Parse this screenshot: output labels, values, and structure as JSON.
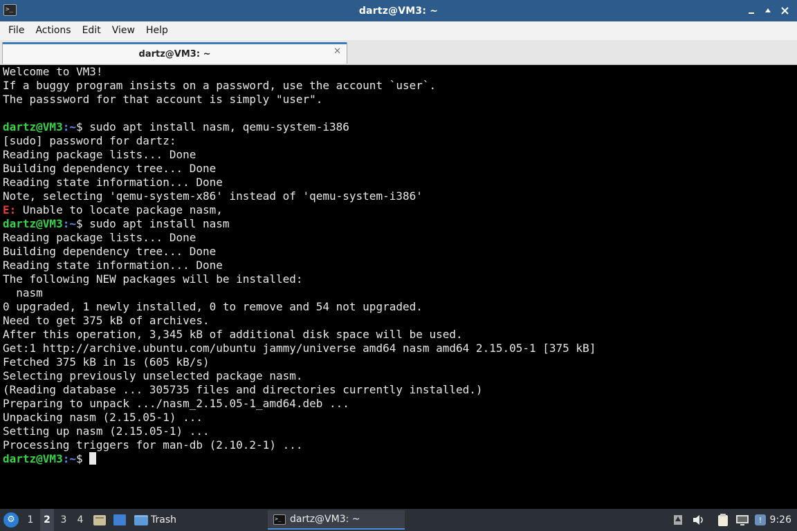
{
  "window": {
    "title": "dartz@VM3: ~",
    "icon": "terminal-icon",
    "controls": [
      "minimize-icon",
      "maximize-icon",
      "close-icon"
    ]
  },
  "menu": {
    "file": "File",
    "actions": "Actions",
    "edit": "Edit",
    "view": "View",
    "help": "Help"
  },
  "tab": {
    "label": "dartz@VM3: ~",
    "close": "✕"
  },
  "prompt": {
    "user_host": "dartz@VM3",
    "path": ":~",
    "symbol": "$ "
  },
  "terminal": {
    "lines": [
      "Welcome to VM3!",
      "If a buggy program insists on a password, use the account `user`.",
      "The passsword for that account is simply \"user\".",
      "",
      "sudo apt install nasm, qemu-system-i386",
      "[sudo] password for dartz:",
      "Reading package lists... Done",
      "Building dependency tree... Done",
      "Reading state information... Done",
      "Note, selecting 'qemu-system-x86' instead of 'qemu-system-i386'",
      "Unable to locate package nasm,",
      "sudo apt install nasm",
      "Reading package lists... Done",
      "Building dependency tree... Done",
      "Reading state information... Done",
      "The following NEW packages will be installed:",
      "  nasm",
      "0 upgraded, 1 newly installed, 0 to remove and 54 not upgraded.",
      "Need to get 375 kB of archives.",
      "After this operation, 3,345 kB of additional disk space will be used.",
      "Get:1 http://archive.ubuntu.com/ubuntu jammy/universe amd64 nasm amd64 2.15.05-1 [375 kB]",
      "Fetched 375 kB in 1s (605 kB/s)",
      "Selecting previously unselected package nasm.",
      "(Reading database ... 305735 files and directories currently installed.)",
      "Preparing to unpack .../nasm_2.15.05-1_amd64.deb ...",
      "Unpacking nasm (2.15.05-1) ...",
      "Setting up nasm (2.15.05-1) ...",
      "Processing triggers for man-db (2.10.2-1) ..."
    ],
    "error_prefix": "E: "
  },
  "taskbar": {
    "workspaces": [
      "1",
      "2",
      "3",
      "4"
    ],
    "active_workspace": "2",
    "trash_label": "Trash",
    "task_label": "dartz@VM3: ~",
    "clock": "9:26",
    "tray_icons": [
      "network-icon",
      "volume-icon",
      "clipboard-icon",
      "display-icon",
      "update-icon"
    ]
  },
  "colors": {
    "titlebar": "#2d5c8c",
    "prompt_user": "#36d248",
    "prompt_path": "#5f8ee8",
    "error": "#e83c3c",
    "terminal_bg": "#000000",
    "taskbar_bg": "#2b2f36"
  }
}
